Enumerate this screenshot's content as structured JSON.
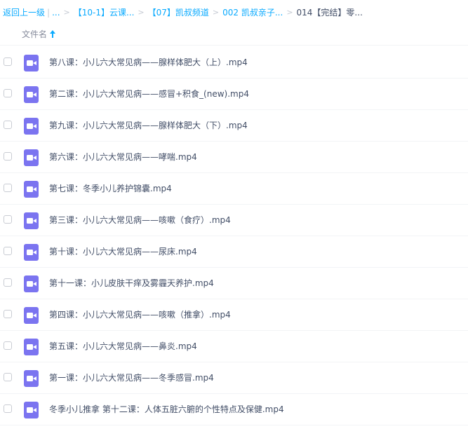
{
  "breadcrumb": {
    "back_label": "返回上一级",
    "pipe": "|",
    "ellipsis": "...",
    "sep": ">",
    "crumbs": [
      "【10-1】云课...",
      "【07】凯叔频道",
      "002 凯叔亲子..."
    ],
    "current": "014【完结】零..."
  },
  "header": {
    "column_label": "文件名",
    "sort_direction": "ascending"
  },
  "colors": {
    "link": "#09aaff",
    "video_icon": "#7b74f0",
    "text": "#424e67"
  },
  "files": [
    {
      "name": "第八课：小儿六大常见病——腺样体肥大（上）.mp4",
      "icon": "video-icon"
    },
    {
      "name": "第二课：小儿六大常见病——感冒+积食_(new).mp4",
      "icon": "video-icon"
    },
    {
      "name": "第九课：小儿六大常见病——腺样体肥大（下）.mp4",
      "icon": "video-icon"
    },
    {
      "name": "第六课：小儿六大常见病——哮喘.mp4",
      "icon": "video-icon"
    },
    {
      "name": "第七课：冬季小儿养护锦囊.mp4",
      "icon": "video-icon"
    },
    {
      "name": "第三课：小儿六大常见病——咳嗽（食疗）.mp4",
      "icon": "video-icon"
    },
    {
      "name": "第十课：小儿六大常见病——尿床.mp4",
      "icon": "video-icon"
    },
    {
      "name": "第十一课：小儿皮肤干痒及雾霾天养护.mp4",
      "icon": "video-icon"
    },
    {
      "name": "第四课：小儿六大常见病——咳嗽（推拿）.mp4",
      "icon": "video-icon"
    },
    {
      "name": "第五课：小儿六大常见病——鼻炎.mp4",
      "icon": "video-icon"
    },
    {
      "name": "第一课：小儿六大常见病——冬季感冒.mp4",
      "icon": "video-icon"
    },
    {
      "name": "冬季小儿推拿 第十二课：人体五脏六腑的个性特点及保健.mp4",
      "icon": "video-icon"
    }
  ]
}
